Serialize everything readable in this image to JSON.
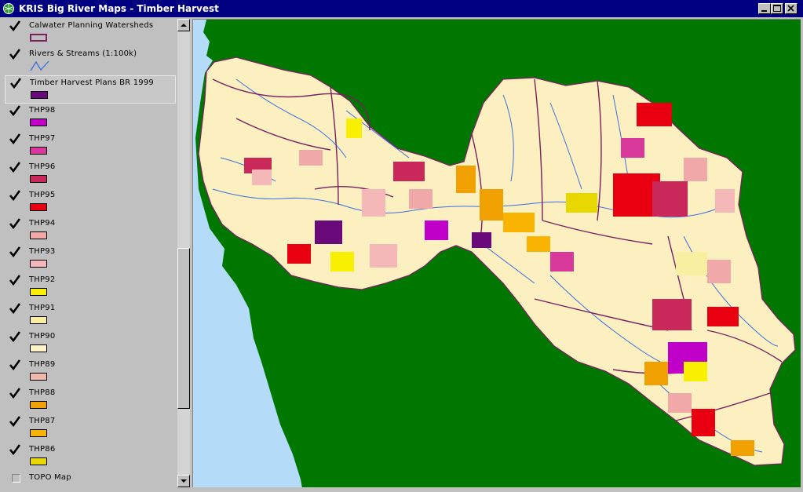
{
  "window": {
    "title": "KRIS Big River Maps - Timber Harvest",
    "controls": [
      "minimize",
      "maximize",
      "close"
    ]
  },
  "legend": {
    "layers": [
      {
        "label": "Calwater Planning Watersheds",
        "checked": true,
        "symbol": "outline",
        "color": "#7a1f5f"
      },
      {
        "label": "Rivers & Streams (1:100k)",
        "checked": true,
        "symbol": "line",
        "color": "#3c6ee0"
      },
      {
        "label": "Timber Harvest Plans BR 1999",
        "checked": true,
        "symbol": "fill",
        "color": "#6a0a7a",
        "selected": true
      },
      {
        "label": "THP98",
        "checked": true,
        "symbol": "fill",
        "color": "#c000c8"
      },
      {
        "label": "THP97",
        "checked": true,
        "symbol": "fill",
        "color": "#d8389a"
      },
      {
        "label": "THP96",
        "checked": true,
        "symbol": "fill",
        "color": "#c8285a"
      },
      {
        "label": "THP95",
        "checked": true,
        "symbol": "fill",
        "color": "#e80010"
      },
      {
        "label": "THP94",
        "checked": true,
        "symbol": "fill",
        "color": "#f0a8a8"
      },
      {
        "label": "THP93",
        "checked": true,
        "symbol": "fill",
        "color": "#f4b8b8"
      },
      {
        "label": "THP92",
        "checked": true,
        "symbol": "fill",
        "color": "#f8f000"
      },
      {
        "label": "THP91",
        "checked": true,
        "symbol": "fill",
        "color": "#f8f0a0"
      },
      {
        "label": "THP90",
        "checked": true,
        "symbol": "fill",
        "color": "#fcf4c8"
      },
      {
        "label": "THP89",
        "checked": true,
        "symbol": "fill",
        "color": "#f0b8a8"
      },
      {
        "label": "THP88",
        "checked": true,
        "symbol": "fill",
        "color": "#f0a000"
      },
      {
        "label": "THP87",
        "checked": true,
        "symbol": "fill",
        "color": "#f8b400"
      },
      {
        "label": "THP86",
        "checked": true,
        "symbol": "fill",
        "color": "#e8d800"
      },
      {
        "label": "TOPO Map",
        "checked": false,
        "symbol": "none",
        "color": ""
      }
    ]
  },
  "map": {
    "colors": {
      "ocean": "#b4dcf8",
      "land": "#007800",
      "watershed_fill": "#fcf0c0",
      "boundary": "#7a1f5f",
      "stream": "#3c6ee0"
    }
  }
}
